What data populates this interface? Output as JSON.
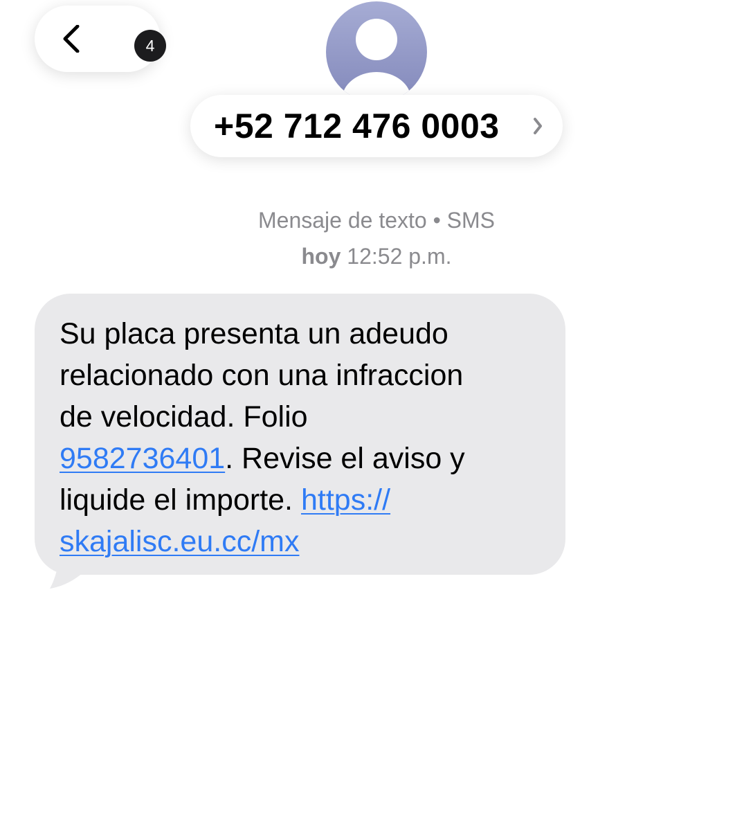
{
  "header": {
    "back_badge_count": "4",
    "back_icon": "chevron-left-icon",
    "avatar_icon": "person-silhouette-icon",
    "contact_number": "+52 712 476 0003",
    "contact_chevron_icon": "chevron-right-icon"
  },
  "meta": {
    "message_type": "Mensaje de texto • SMS",
    "day": "hoy",
    "time": "12:52 p.m."
  },
  "message": {
    "lines": [
      "Su placa presenta un adeudo",
      "relacionado con una infraccion",
      "de velocidad. Folio"
    ],
    "folio_link": "9582736401",
    "after_folio": ". Revise el aviso y",
    "before_url": "liquide el importe. ",
    "url_part1": "https://",
    "url_part2": "skajalisc.eu.cc/mx"
  },
  "colors": {
    "bubble": "#e9e9eb",
    "link": "#2f7bf5",
    "meta_text": "#8a8a8e",
    "avatar": "#8e94c4"
  }
}
